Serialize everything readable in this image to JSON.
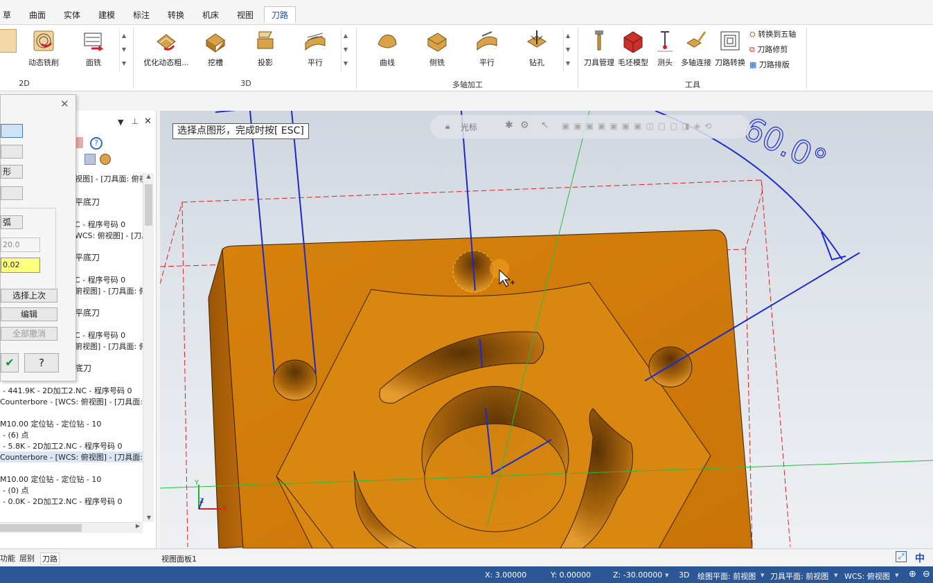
{
  "tabs": [
    "草图",
    "曲面",
    "实体",
    "建模",
    "标注",
    "转换",
    "机床",
    "视图",
    "刀路"
  ],
  "active_tab": "刀路",
  "ribbon": {
    "group_2d": {
      "label": "2D",
      "buttons": [
        "动态铣削",
        "面铣"
      ]
    },
    "group_3d": {
      "label": "3D",
      "buttons": [
        "优化动态粗...",
        "挖槽",
        "投影",
        "平行"
      ]
    },
    "group_multi": {
      "label": "多轴加工",
      "buttons": [
        "曲线",
        "侧铣",
        "平行",
        "钻孔"
      ]
    },
    "group_tools": {
      "label": "工具",
      "buttons": [
        "刀具管理",
        "毛坯模型",
        "测头",
        "多轴连接",
        "刀路转换"
      ],
      "small_buttons": [
        "转换到五轴",
        "刀路修剪",
        "刀路排版"
      ]
    }
  },
  "dialog": {
    "btn_arc_partial": "弧",
    "btn_shape_partial": "形",
    "field1_value": "20.0",
    "field2_value": "0.02",
    "select_last": "选择上次",
    "edit": "编辑",
    "cancel_all": "全部撤消"
  },
  "manager": {
    "lines": [
      "视图] - [刀具面: 俯视",
      "平底刀",
      "C - 程序号码 0",
      "WCS: 俯视图] - [刀具",
      "平底刀",
      "C - 程序号码 0",
      "俯视图] - [刀具面: 俯",
      "平底刀",
      "C - 程序号码 0",
      "俯视图] - [刀具面: 俯",
      "底刀",
      "- 441.9K - 2D加工2.NC - 程序号码 0",
      "Counterbore - [WCS: 俯视图] - [刀具面: 俯",
      "M10.00 定位钻 - 定位钻 - 10",
      "- (6) 点",
      "- 5.8K - 2D加工2.NC - 程序号码 0",
      "Counterbore - [WCS: 俯视图] - [刀具面: 前",
      "M10.00 定位钻 - 定位钻 - 10",
      "- (0) 点",
      "- 0.0K - 2D加工2.NC - 程序号码 0"
    ]
  },
  "bottom_tabs": [
    "功能",
    "层别",
    "刀路"
  ],
  "viewport": {
    "prompt": "选择点图形，完成时按[ ESC]",
    "quickbar_label": "光标",
    "dimension": "60.0°",
    "view_tab": "视图面板1"
  },
  "status": {
    "x": "X:  3.00000",
    "y": "Y:  0.00000",
    "z": "Z:  -30.00000",
    "mode": "3D",
    "draw_plane": "绘图平面: 前视图",
    "tool_plane": "刀具平面: 前视图",
    "wcs": "WCS: 俯视图"
  },
  "ime_label": "中"
}
